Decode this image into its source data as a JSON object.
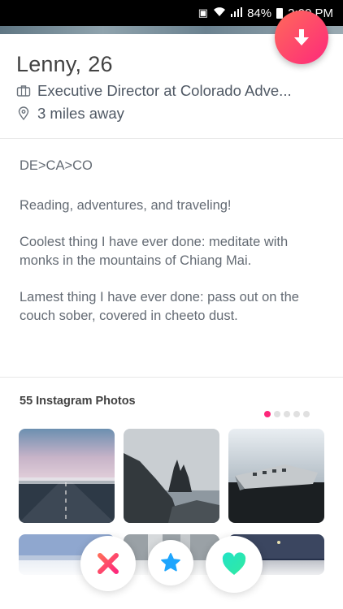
{
  "status_bar": {
    "battery": "84%",
    "time": "2:00 PM"
  },
  "profile": {
    "name": "Lenny,",
    "age": "26",
    "job": "Executive Director at Colorado Adve...",
    "distance": "3 miles away"
  },
  "bio": {
    "headline": "DE>CA>CO",
    "paragraphs": [
      "Reading,  adventures, and traveling!",
      "Coolest thing I have ever done: meditate with monks in the mountains of Chiang Mai.",
      "Lamest thing I have ever done: pass out on the couch sober, covered in cheeto dust."
    ]
  },
  "instagram": {
    "title": "55 Instagram Photos",
    "page_count": 5,
    "active_page": 1
  },
  "colors": {
    "brand_gradient_start": "#ff6a5a",
    "brand_gradient_end": "#fd297b",
    "nope": "#fd5068",
    "super_like": "#1ea5fd",
    "like": "#2ce6b5"
  },
  "icons": {
    "info_fab": "arrow-down-icon",
    "job": "briefcase-icon",
    "distance": "location-pin-icon",
    "nope": "close-x-icon",
    "super_like": "star-icon",
    "like": "heart-icon"
  }
}
